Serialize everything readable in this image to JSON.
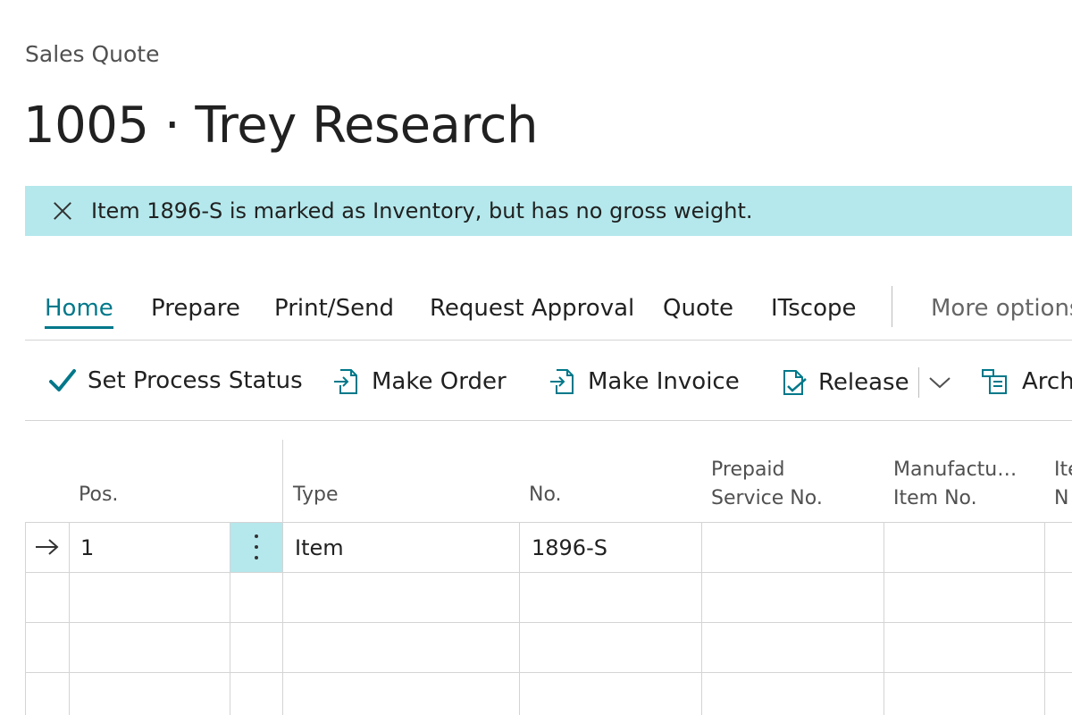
{
  "page": {
    "caption": "Sales Quote",
    "title": "1005 · Trey Research"
  },
  "notification": {
    "message": "Item 1896-S is marked as Inventory, but has no gross weight.",
    "close_icon": "close-icon"
  },
  "tabs": [
    {
      "label": "Home",
      "active": true
    },
    {
      "label": "Prepare"
    },
    {
      "label": "Print/Send"
    },
    {
      "label": "Request Approval"
    },
    {
      "label": "Quote"
    },
    {
      "label": "ITscope"
    }
  ],
  "more_options": "More options",
  "actions": [
    {
      "label": "Set Process Status",
      "icon": "checkmark-icon"
    },
    {
      "label": "Make Order",
      "icon": "make-order-icon"
    },
    {
      "label": "Make Invoice",
      "icon": "make-invoice-icon"
    },
    {
      "label": "Release",
      "icon": "release-icon"
    },
    {
      "label": "Archi",
      "icon": "archive-icon"
    }
  ],
  "table": {
    "columns": {
      "pos": "Pos.",
      "type": "Type",
      "no": "No.",
      "prepaid_1": "Prepaid",
      "prepaid_2": "Service No.",
      "manuf_1": "Manufactu…",
      "manuf_2": "Item No.",
      "item_1": "Ite",
      "item_2": "N"
    },
    "rows": [
      {
        "pos": "1",
        "type": "Item",
        "no": "1896-S"
      }
    ]
  },
  "colors": {
    "accent": "#00788a",
    "banner_bg": "#b4e8ec"
  }
}
